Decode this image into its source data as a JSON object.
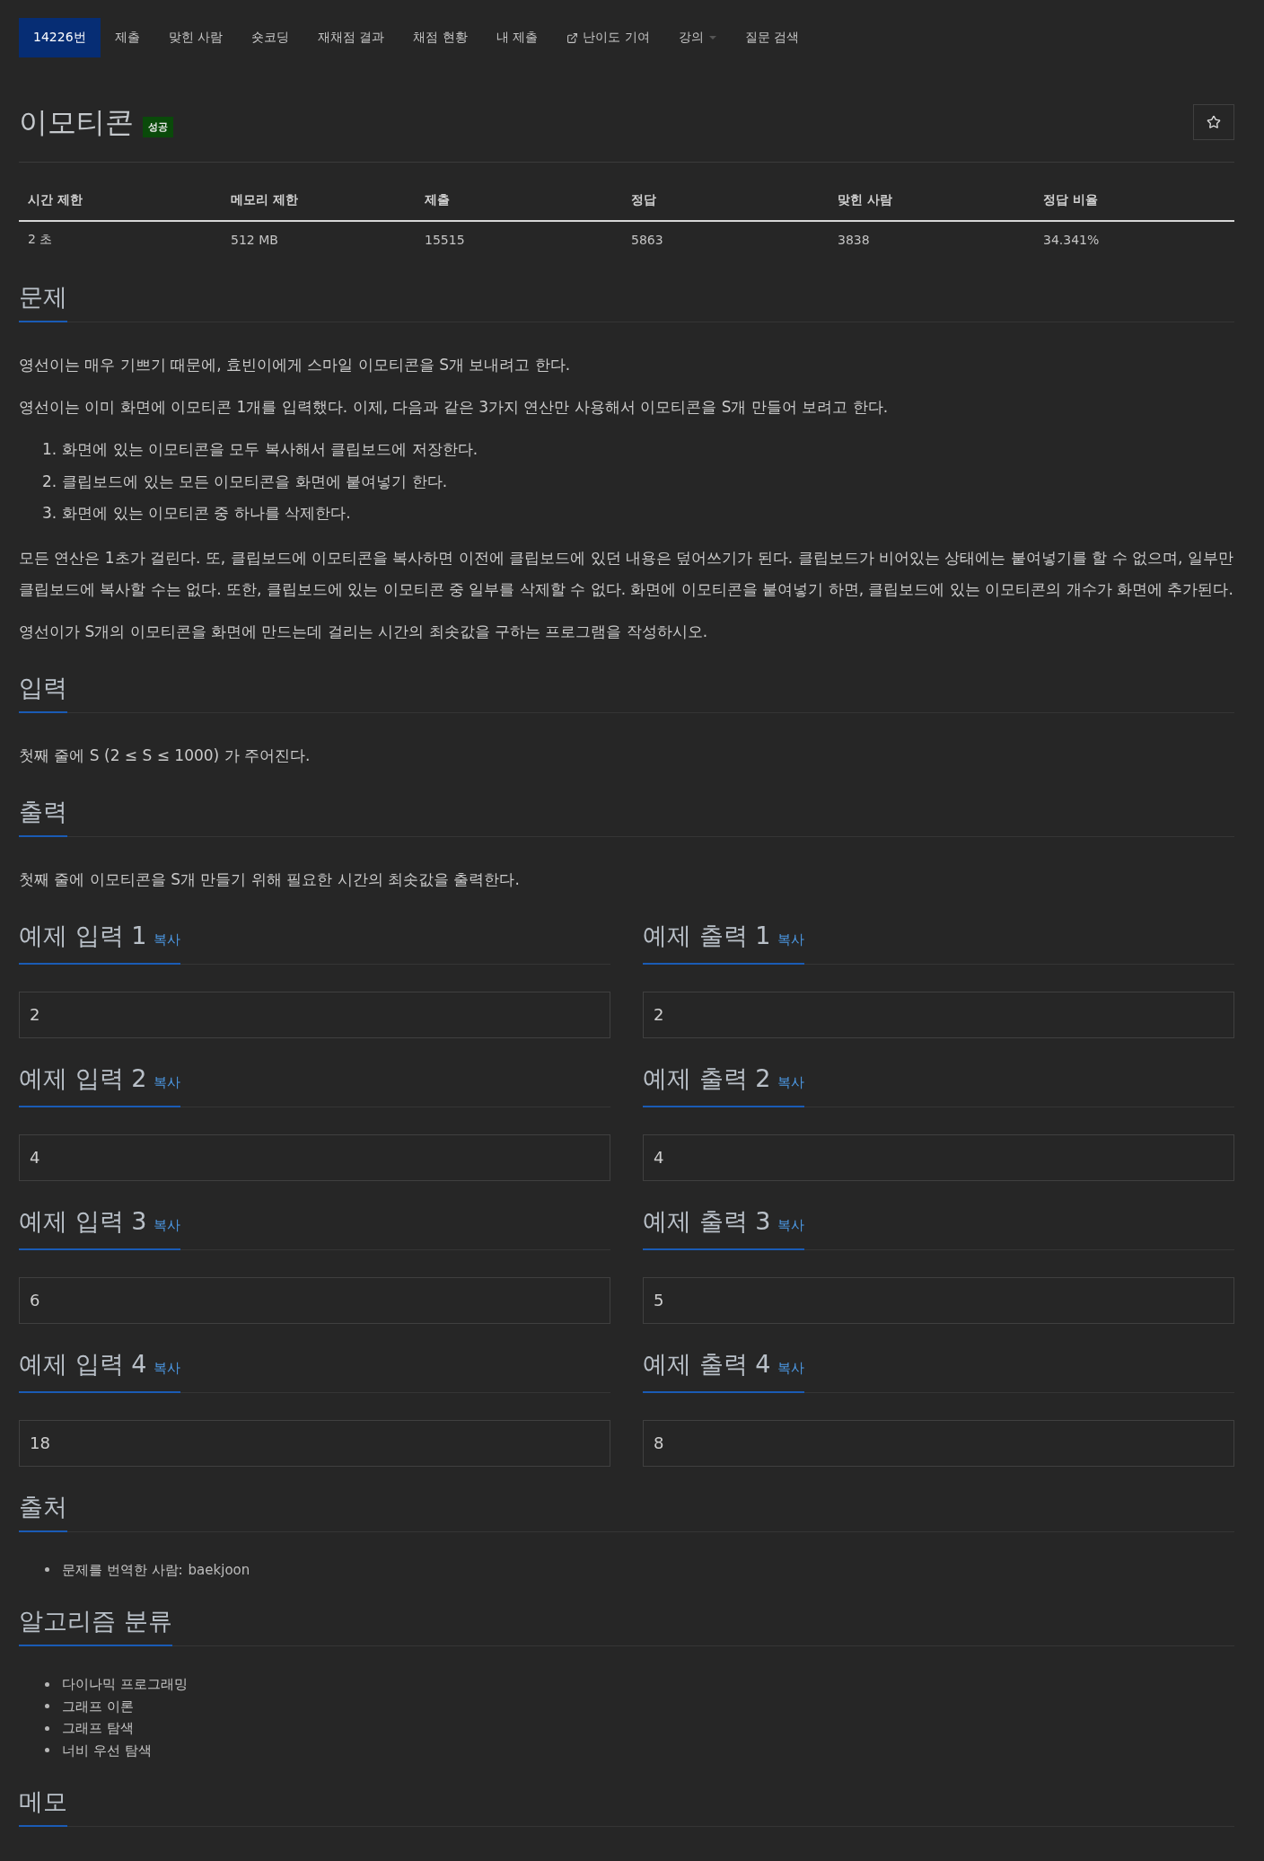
{
  "nav": [
    {
      "label": "14226번",
      "selected": true,
      "kind": "plain"
    },
    {
      "label": "제출",
      "selected": false,
      "kind": "plain"
    },
    {
      "label": "맞힌 사람",
      "selected": false,
      "kind": "plain"
    },
    {
      "label": "숏코딩",
      "selected": false,
      "kind": "plain"
    },
    {
      "label": "재채점 결과",
      "selected": false,
      "kind": "plain"
    },
    {
      "label": "채점 현황",
      "selected": false,
      "kind": "plain"
    },
    {
      "label": "내 제출",
      "selected": false,
      "kind": "plain"
    },
    {
      "label": "난이도 기여",
      "selected": false,
      "kind": "external"
    },
    {
      "label": "강의",
      "selected": false,
      "kind": "dropdown"
    },
    {
      "label": "질문 검색",
      "selected": false,
      "kind": "plain"
    }
  ],
  "title": "이모티콘",
  "badge": "성공",
  "stats": {
    "columns": [
      "시간 제한",
      "메모리 제한",
      "제출",
      "정답",
      "맞힌 사람",
      "정답 비율"
    ],
    "values": [
      "2 초",
      "512 MB",
      "15515",
      "5863",
      "3838",
      "34.341%"
    ]
  },
  "problem": {
    "heading": "문제",
    "blocks": [
      {
        "kind": "p",
        "text": "영선이는 매우 기쁘기 때문에, 효빈이에게 스마일 이모티콘을 S개 보내려고 한다."
      },
      {
        "kind": "p",
        "text": "영선이는 이미 화면에 이모티콘 1개를 입력했다. 이제, 다음과 같은 3가지 연산만 사용해서 이모티콘을 S개 만들어 보려고 한다."
      },
      {
        "kind": "ol",
        "items": [
          {
            "num": "1.",
            "text": "화면에 있는 이모티콘을 모두 복사해서 클립보드에 저장한다."
          },
          {
            "num": "2.",
            "text": "클립보드에 있는 모든 이모티콘을 화면에 붙여넣기 한다."
          },
          {
            "num": "3.",
            "text": "화면에 있는 이모티콘 중 하나를 삭제한다."
          }
        ]
      },
      {
        "kind": "p",
        "text": "모든 연산은 1초가 걸린다. 또, 클립보드에 이모티콘을 복사하면 이전에 클립보드에 있던 내용은 덮어쓰기가 된다. 클립보드가 비어있는 상태에는 붙여넣기를 할 수 없으며, 일부만 클립보드에 복사할 수는 없다. 또한, 클립보드에 있는 이모티콘 중 일부를 삭제할 수 없다. 화면에 이모티콘을 붙여넣기 하면, 클립보드에 있는 이모티콘의 개수가 화면에 추가된다."
      },
      {
        "kind": "p",
        "text": "영선이가 S개의 이모티콘을 화면에 만드는데 걸리는 시간의 최솟값을 구하는 프로그램을 작성하시오."
      }
    ]
  },
  "input": {
    "heading": "입력",
    "text": "첫째 줄에 S (2 ≤ S ≤ 1000) 가 주어진다."
  },
  "output": {
    "heading": "출력",
    "text": "첫째 줄에 이모티콘을 S개 만들기 위해 필요한 시간의 최솟값을 출력한다."
  },
  "examples": [
    {
      "input": {
        "heading": "예제 입력 1",
        "copy": "복사",
        "value": "2"
      },
      "output": {
        "heading": "예제 출력 1",
        "copy": "복사",
        "value": "2"
      }
    },
    {
      "input": {
        "heading": "예제 입력 2",
        "copy": "복사",
        "value": "4"
      },
      "output": {
        "heading": "예제 출력 2",
        "copy": "복사",
        "value": "4"
      }
    },
    {
      "input": {
        "heading": "예제 입력 3",
        "copy": "복사",
        "value": "6"
      },
      "output": {
        "heading": "예제 출력 3",
        "copy": "복사",
        "value": "5"
      }
    },
    {
      "input": {
        "heading": "예제 입력 4",
        "copy": "복사",
        "value": "18"
      },
      "output": {
        "heading": "예제 출력 4",
        "copy": "복사",
        "value": "8"
      }
    }
  ],
  "source": {
    "heading": "출처",
    "items": [
      {
        "label": "문제를 번역한 사람:",
        "link": "baekjoon"
      }
    ]
  },
  "algorithms": {
    "heading": "알고리즘 분류",
    "items": [
      "다이나믹 프로그래밍",
      "그래프 이론",
      "그래프 탐색",
      "너비 우선 탐색"
    ]
  },
  "memo": {
    "heading": "메모"
  }
}
